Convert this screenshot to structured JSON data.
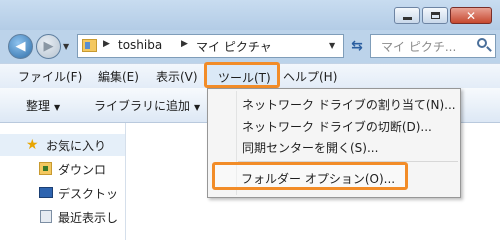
{
  "nav": {
    "breadcrumbs": [
      "toshiba",
      "マイ ピクチャ"
    ],
    "search_placeholder": "マイ ピクチ..."
  },
  "menubar": {
    "file": "ファイル(F)",
    "edit": "編集(E)",
    "view": "表示(V)",
    "tools": "ツール(T)",
    "help": "ヘルプ(H)"
  },
  "commandbar": {
    "organize": "整理",
    "add_to_library": "ライブラリに追加"
  },
  "sidebar": {
    "favorites": "お気に入り",
    "items": [
      "ダウンロ",
      "デスクトッ",
      "最近表示し"
    ]
  },
  "tools_menu": {
    "items": [
      "ネットワーク ドライブの割り当て(N)...",
      "ネットワーク ドライブの切断(D)...",
      "同期センターを開く(S)...",
      "フォルダー オプション(O)..."
    ]
  },
  "colors": {
    "highlight": "#f28c28",
    "window_frame": "#bcd3ea"
  }
}
